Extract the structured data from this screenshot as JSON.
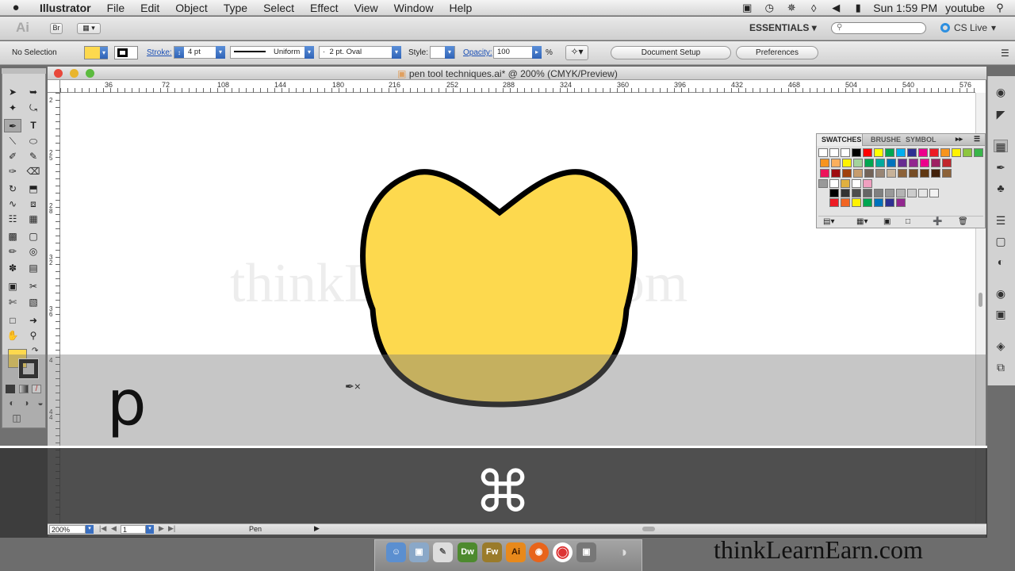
{
  "menubar": {
    "apple": "",
    "items": [
      "Illustrator",
      "File",
      "Edit",
      "Object",
      "Type",
      "Select",
      "Effect",
      "View",
      "Window",
      "Help"
    ],
    "clock": "Sun 1:59 PM",
    "user": "youtube"
  },
  "appbar": {
    "logo": "Ai",
    "bridge": "Br",
    "workspace": "ESSENTIALS",
    "cslive": "CS Live"
  },
  "control": {
    "selection": "No Selection",
    "stroke_label": "Stroke:",
    "stroke_value": "4 pt",
    "profile": "Uniform",
    "brush": "2 pt. Oval",
    "style_label": "Style:",
    "opacity_label": "Opacity:",
    "opacity_value": "100",
    "percent": "%",
    "doc_setup": "Document Setup",
    "preferences": "Preferences"
  },
  "document": {
    "title": "pen tool techniques.ai* @ 200% (CMYK/Preview)",
    "zoom": "200%",
    "page": "1",
    "status": "Pen",
    "watermark": "thinkLearnEarn.com"
  },
  "ruler": {
    "h": [
      "36",
      "72",
      "108",
      "144",
      "180",
      "216",
      "252",
      "288",
      "324",
      "360",
      "396",
      "432",
      "468",
      "504",
      "540",
      "576"
    ],
    "v": [
      "2",
      "2 5",
      "2 8",
      "3 2",
      "3 6",
      "4",
      "4 4"
    ]
  },
  "overlay": {
    "key1": "p",
    "key2": "⌘"
  },
  "swatches": {
    "tabs": [
      "SWATCHES",
      "BRUSHE",
      "SYMBOL"
    ],
    "row1": [
      "#ff0000",
      "#ffff00",
      "#00a651",
      "#00aeef",
      "#2e3192",
      "#ec008c",
      "#ed1c24",
      "#f7941d",
      "#fff200",
      "#8dc63f",
      "#39b54a"
    ],
    "row2": [
      "#f7941d",
      "#fbaf5d",
      "#fff200",
      "#a3d39c",
      "#00a651",
      "#00a99d",
      "#0072bc",
      "#662d91",
      "#92278f",
      "#ec008c",
      "#9e1f63",
      "#c1272d"
    ],
    "row3": [
      "#ed145b",
      "#9e0b0f",
      "#a0410d",
      "#c69c6d",
      "#736357",
      "#998675",
      "#c7b299",
      "#8c6239",
      "#754c24",
      "#603813",
      "#42210b",
      "#8c6239"
    ],
    "grays": [
      "#000000",
      "#333333",
      "#4d4d4d",
      "#666666",
      "#808080",
      "#999999",
      "#b3b3b3",
      "#cccccc",
      "#e6e6e6",
      "#f2f2f2"
    ],
    "brights": [
      "#ed1c24",
      "#f26522",
      "#fff200",
      "#00a651",
      "#0072bc",
      "#2e3192",
      "#92278f"
    ]
  },
  "shape": {
    "fill": "#fdd94e",
    "stroke": "#000000"
  },
  "dock": {
    "apps": [
      "Dw",
      "Fw",
      "Ai"
    ]
  },
  "brand": "thinkLearnEarn.com"
}
